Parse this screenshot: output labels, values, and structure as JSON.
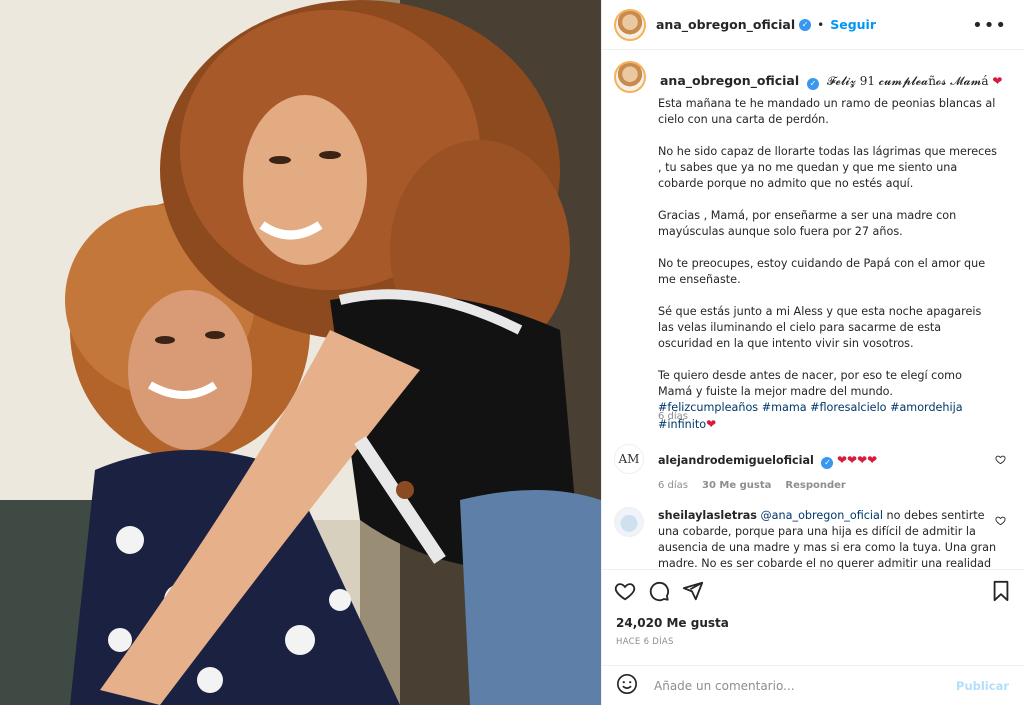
{
  "header": {
    "username": "ana_obregon_oficial",
    "separator": "•",
    "follow_label": "Seguir",
    "more_label": "•••"
  },
  "caption": {
    "username": "ana_obregon_oficial",
    "title": "𝓕𝓮𝓵𝓲𝔃 91 𝓬𝓾𝓶𝓹𝓵𝓮𝓪ñ𝓸𝓼 𝓜𝓪𝓶á",
    "title_plain": "Feliz 91 cumpleaños Mamá",
    "heart": "❤",
    "paragraphs": [
      "Esta mañana te he mandado un ramo de peonias blancas al cielo con una carta de perdón.",
      "No he sido capaz de llorarte todas las lágrimas que mereces , tu sabes que ya no me quedan y que me siento una cobarde porque no admito que no estés aquí.",
      "Gracias , Mamá, por enseñarme a ser una madre con mayúsculas aunque solo fuera por 27 años.",
      "No te preocupes, estoy cuidando de Papá con el amor que me enseñaste.",
      "Sé que estás junto a mi Aless y que esta noche apagareis las velas iluminando el cielo para sacarme de esta oscuridad en la que intento vivir sin vosotros."
    ],
    "last_paragraph": "Te quiero desde antes de nacer, por eso te elegí como Mamá y fuiste la mejor madre del mundo.",
    "hashtags": "#felizcumpleaños #mama #floresalcielo #amordehija #infinito",
    "hashtag_heart": "❤",
    "age": "6 días"
  },
  "comments": [
    {
      "avatar_text": "AM",
      "username": "alejandrodemigueloficial",
      "text": "❤❤❤❤",
      "age": "6 días",
      "likes": "30 Me gusta",
      "reply": "Responder"
    },
    {
      "username": "sheilaylasletras",
      "mention": "@ana_obregon_oficial",
      "text": " no debes sentirte una cobarde, porque para una hija es difícil de admitir la ausencia de una madre y mas si era como la tuya. Una gran madre. No es ser cobarde el no querer admitir una realidad que tanto"
    }
  ],
  "actions": {
    "likes_text": "24,020 Me gusta",
    "posted_ago": "HACE 6 DÍAS"
  },
  "add_comment": {
    "placeholder": "Añade un comentario...",
    "publish_label": "Publicar"
  },
  "colors": {
    "accent": "#0095f6",
    "verified": "#3897f0",
    "heart": "#d81b3c",
    "link": "#00376b",
    "muted": "#8e8e8e",
    "publish_disabled": "#b2dffc"
  },
  "icons": {
    "like": "heart-outline-icon",
    "comment": "comment-bubble-icon",
    "share": "paper-plane-icon",
    "save": "bookmark-icon",
    "emoji": "smiley-icon",
    "verified": "verified-badge-icon",
    "more": "more-options-icon"
  }
}
